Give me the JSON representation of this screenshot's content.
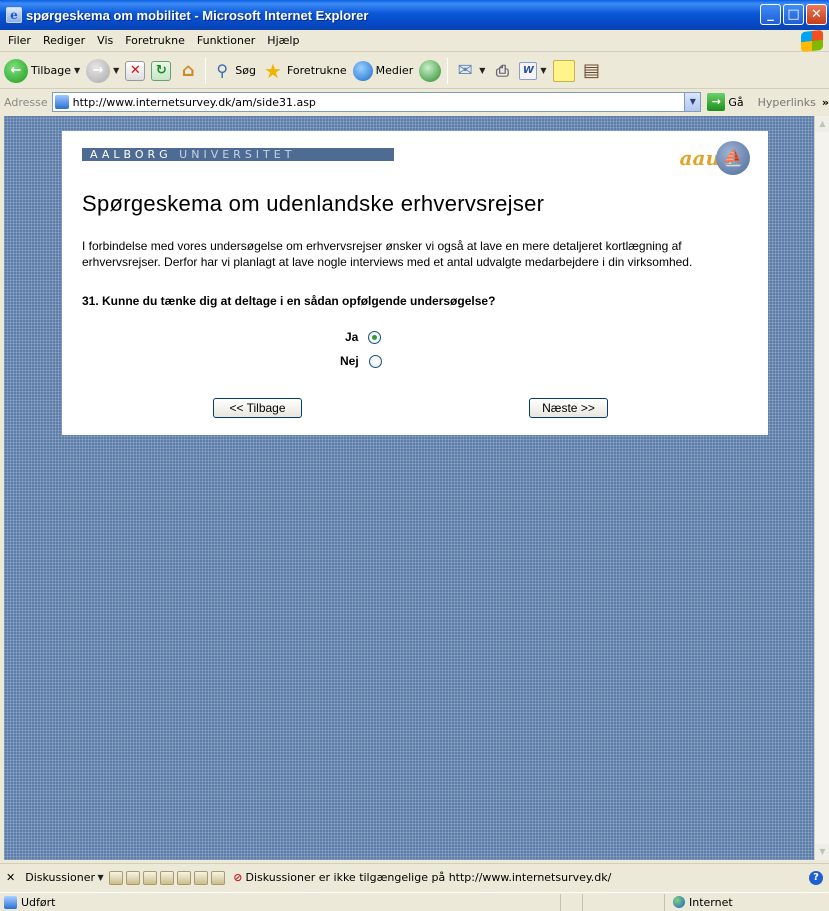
{
  "window": {
    "title": "spørgeskema om mobilitet - Microsoft Internet Explorer"
  },
  "menu": [
    "Filer",
    "Rediger",
    "Vis",
    "Foretrukne",
    "Funktioner",
    "Hjælp"
  ],
  "toolbar": {
    "back_label": "Tilbage",
    "search_label": "Søg",
    "favorites_label": "Foretrukne",
    "media_label": "Medier"
  },
  "address": {
    "label": "Adresse",
    "url": "http://www.internetsurvey.dk/am/side31.asp",
    "go_label": "Gå",
    "links_label": "Hyperlinks"
  },
  "page": {
    "logo_aalborg": "AALBORG",
    "logo_universitet": "UNIVERSITET",
    "logo_aau": "aau",
    "heading": "Spørgeskema om udenlandske erhvervsrejser",
    "intro": "I forbindelse med vores undersøgelse om erhvervsrejser ønsker vi også at lave en mere detaljeret kortlægning af erhvervsrejser. Derfor har vi planlagt at lave nogle interviews med et antal udvalgte medarbejdere i din virksomhed.",
    "question": "31. Kunne du tænke dig at deltage i en sådan opfølgende undersøgelse?",
    "options": [
      {
        "label": "Ja",
        "selected": true
      },
      {
        "label": "Nej",
        "selected": false
      }
    ],
    "back_button": "<< Tilbage",
    "next_button": "Næste >>"
  },
  "discussion": {
    "label": "Diskussioner",
    "message": "Diskussioner er ikke tilgængelige på http://www.internetsurvey.dk/"
  },
  "status": {
    "text": "Udført",
    "zone": "Internet"
  }
}
